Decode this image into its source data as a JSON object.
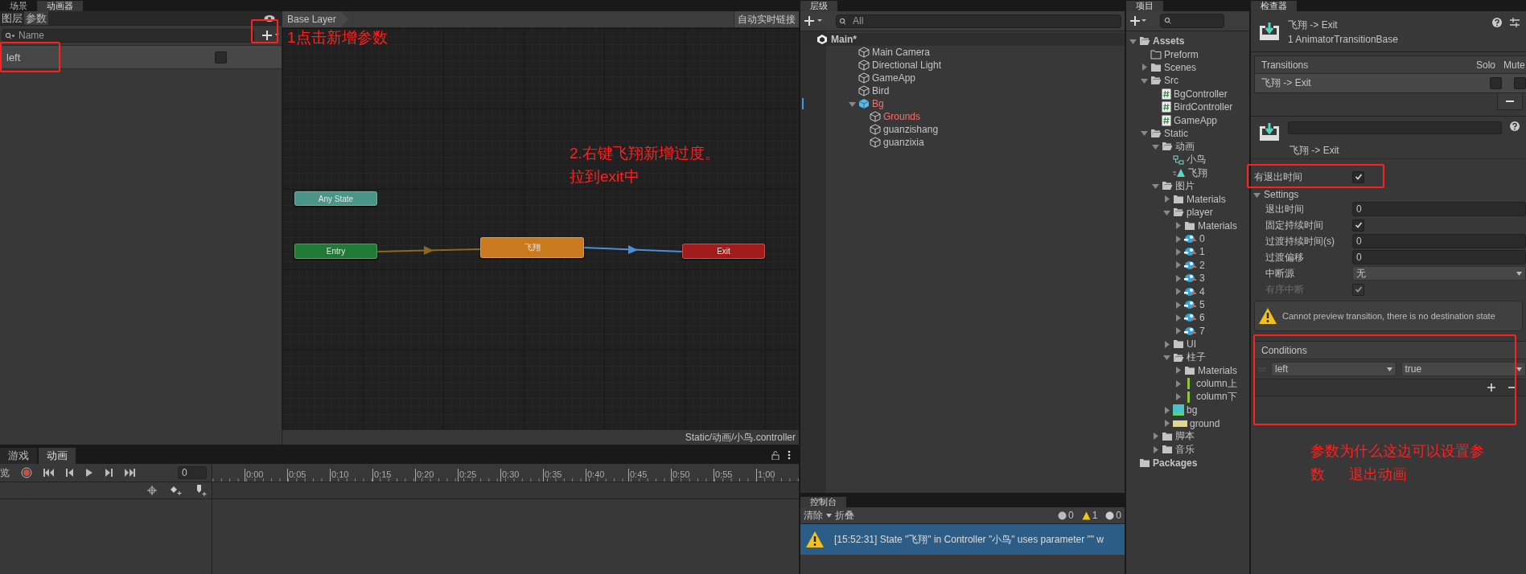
{
  "animator": {
    "tabs": [
      {
        "label": "场景",
        "selected": false
      },
      {
        "label": "动画器",
        "selected": true
      }
    ],
    "side_tabs": [
      {
        "label": "图层",
        "selected": false
      },
      {
        "label": "参数",
        "selected": true
      }
    ],
    "search": {
      "placeholder": "Name"
    },
    "parameters": [
      {
        "name": "left",
        "checked": false
      }
    ],
    "breadcrumb": "Base Layer",
    "live_link_button": "自动实时链接",
    "nodes": [
      {
        "label": "Any State",
        "kind": "any"
      },
      {
        "label": "Entry",
        "kind": "entry"
      },
      {
        "label": "飞翔",
        "kind": "state"
      },
      {
        "label": "Exit",
        "kind": "exit"
      }
    ],
    "path": "Static/动画/小鸟.controller",
    "notes": [
      "1点击新增参数",
      "2.右键飞翔新增过度。",
      "拉到exit中"
    ]
  },
  "animation": {
    "tabs": [
      {
        "label": "游戏",
        "selected": false
      },
      {
        "label": "动画",
        "selected": true
      }
    ],
    "preview": "览",
    "frame": "0",
    "ticks": [
      "0:00",
      "0:05",
      "0:10",
      "0:15",
      "0:20",
      "0:25",
      "0:30",
      "0:35",
      "0:40",
      "0:45",
      "0:50",
      "0:55",
      "1:00"
    ]
  },
  "hierarchy": {
    "title": "层级",
    "search": {
      "placeholder": "All"
    },
    "scene": "Main*",
    "items": [
      {
        "name": "Main Camera",
        "kind": "object",
        "missing": false,
        "changed": false
      },
      {
        "name": "Directional Light",
        "kind": "object",
        "missing": false,
        "changed": false
      },
      {
        "name": "GameApp",
        "kind": "object",
        "missing": false,
        "changed": false
      },
      {
        "name": "Bird",
        "kind": "object",
        "missing": false,
        "changed": false
      },
      {
        "name": "Bg",
        "kind": "prefab",
        "missing": true,
        "changed": true,
        "expanded": true,
        "children": [
          {
            "name": "Grounds",
            "kind": "object",
            "missing": true,
            "changed": false
          },
          {
            "name": "guanzishang",
            "kind": "object",
            "missing": false,
            "changed": false
          },
          {
            "name": "guanzixia",
            "kind": "object",
            "missing": false,
            "changed": false
          }
        ]
      }
    ]
  },
  "project": {
    "title": "项目",
    "items": [
      {
        "name": "Assets",
        "kind": "folder",
        "bold": true,
        "expanded": true,
        "children": [
          {
            "name": "Preform",
            "kind": "empty-folder",
            "bold": false
          },
          {
            "name": "Scenes",
            "kind": "folder",
            "bold": false,
            "expanded": false
          },
          {
            "name": "Src",
            "kind": "folder",
            "bold": false,
            "expanded": true,
            "children": [
              {
                "name": "BgController",
                "kind": "script",
                "bold": false
              },
              {
                "name": "BirdController",
                "kind": "script",
                "bold": false
              },
              {
                "name": "GameApp",
                "kind": "script",
                "bold": false
              }
            ]
          },
          {
            "name": "Static",
            "kind": "folder",
            "bold": false,
            "expanded": true,
            "children": [
              {
                "name": "动画",
                "kind": "folder",
                "bold": false,
                "expanded": true,
                "children": [
                  {
                    "name": "小鸟",
                    "kind": "controller",
                    "bold": false
                  },
                  {
                    "name": "飞翔",
                    "kind": "clip",
                    "bold": false
                  }
                ]
              },
              {
                "name": "图片",
                "kind": "folder",
                "bold": false,
                "expanded": true,
                "children": [
                  {
                    "name": "Materials",
                    "kind": "folder",
                    "bold": false,
                    "expanded": false
                  },
                  {
                    "name": "player",
                    "kind": "folder",
                    "bold": false,
                    "expanded": true,
                    "children": [
                      {
                        "name": "Materials",
                        "kind": "folder",
                        "bold": false,
                        "expanded": false
                      },
                      {
                        "name": "0",
                        "kind": "bird",
                        "bold": false,
                        "expanded": false
                      },
                      {
                        "name": "1",
                        "kind": "bird",
                        "bold": false,
                        "expanded": false
                      },
                      {
                        "name": "2",
                        "kind": "bird",
                        "bold": false,
                        "expanded": false
                      },
                      {
                        "name": "3",
                        "kind": "bird",
                        "bold": false,
                        "expanded": false
                      },
                      {
                        "name": "4",
                        "kind": "bird",
                        "bold": false,
                        "expanded": false
                      },
                      {
                        "name": "5",
                        "kind": "bird",
                        "bold": false,
                        "expanded": false
                      },
                      {
                        "name": "6",
                        "kind": "bird",
                        "bold": false,
                        "expanded": false
                      },
                      {
                        "name": "7",
                        "kind": "bird",
                        "bold": false,
                        "expanded": false
                      }
                    ]
                  },
                  {
                    "name": "UI",
                    "kind": "folder",
                    "bold": false,
                    "expanded": false
                  },
                  {
                    "name": "柱子",
                    "kind": "folder",
                    "bold": false,
                    "expanded": true,
                    "children": [
                      {
                        "name": "Materials",
                        "kind": "folder",
                        "bold": false,
                        "expanded": false
                      },
                      {
                        "name": "column上",
                        "kind": "column",
                        "bold": false,
                        "expanded": false
                      },
                      {
                        "name": "column下",
                        "kind": "column",
                        "bold": false,
                        "expanded": false
                      }
                    ]
                  },
                  {
                    "name": "bg",
                    "kind": "bg-sprite",
                    "bold": false,
                    "expanded": false
                  },
                  {
                    "name": "ground",
                    "kind": "ground-sprite",
                    "bold": false,
                    "expanded": false
                  }
                ]
              },
              {
                "name": "脚本",
                "kind": "folder",
                "bold": false,
                "expanded": false
              },
              {
                "name": "音乐",
                "kind": "folder",
                "bold": false,
                "expanded": false
              }
            ]
          }
        ]
      },
      {
        "name": "Packages",
        "kind": "folder",
        "bold": true
      }
    ]
  },
  "console": {
    "title": "控制台",
    "clear_button": "清除",
    "collapse_button": "折叠",
    "counts": [
      {
        "kind": "info",
        "value": "0"
      },
      {
        "kind": "warning",
        "value": "1"
      },
      {
        "kind": "error",
        "value": "0"
      }
    ],
    "messages": [
      {
        "kind": "warning",
        "selected": true,
        "text": "[15:52:31] State \"飞翔\" in Controller \"小鸟\" uses parameter \"\" w"
      }
    ]
  },
  "inspector": {
    "title": "检查器",
    "header": {
      "title": "飞翔 -> Exit",
      "subtitle": "1 AnimatorTransitionBase"
    },
    "transitions": {
      "heading": "Transitions",
      "solo_label": "Solo",
      "mute_label": "Mute",
      "rows": [
        {
          "name": "飞翔 -> Exit",
          "solo": false,
          "mute": false,
          "selected": true
        }
      ]
    },
    "transition_label": "飞翔 -> Exit",
    "has_exit_time": {
      "label": "有退出时间",
      "checked": true
    },
    "settings": {
      "label": "Settings",
      "expanded": true,
      "fields": [
        {
          "label": "退出时间",
          "kind": "number",
          "value": "0"
        },
        {
          "label": "固定持续时间",
          "kind": "checkbox",
          "checked": true,
          "disabled": false
        },
        {
          "label": "过渡持续时间(s)",
          "kind": "number",
          "value": "0"
        },
        {
          "label": "过渡偏移",
          "kind": "number",
          "value": "0"
        },
        {
          "label": "中断源",
          "kind": "dropdown",
          "value": "无"
        },
        {
          "label": "有序中断",
          "kind": "checkbox",
          "checked": true,
          "disabled": true
        }
      ]
    },
    "warning": "Cannot preview transition, there is no destination state",
    "conditions": {
      "heading": "Conditions",
      "rows": [
        {
          "parameter": "left",
          "value": "true"
        }
      ]
    },
    "note": "参数为什么这边可以设置参数      退出动画"
  }
}
